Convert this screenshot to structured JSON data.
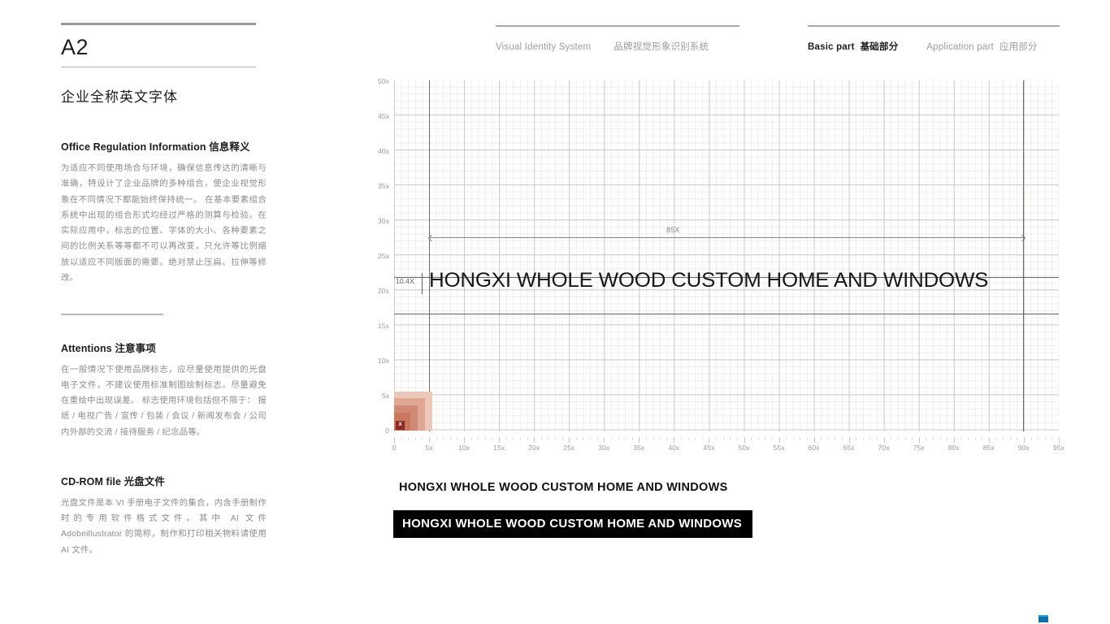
{
  "page": {
    "code": "A2",
    "section_title": "企业全称英文字体"
  },
  "header": {
    "left": {
      "en": "Visual Identity System",
      "cn": "品牌视觉形象识别系统"
    },
    "right": {
      "basic_en": "Basic part",
      "basic_cn": "基础部分",
      "application_en": "Application part",
      "application_cn": "应用部分"
    }
  },
  "sidebar": {
    "blocks": [
      {
        "head_en": "Office Regulation Information",
        "head_cn": "信息释义",
        "body": "为适应不同使用场合与环境，确保信息传达的清晰与准确，特设计了企业品牌的多种组合，使企业视觉形象在不同情况下都能始终保持统一。\n在基本要素组合系统中出现的组合形式均经过严格的测算与检验。在实际应用中，标志的位置、字体的大小、各种要素之间的比例关系等等都不可以再改变，只允许等比例缩放以适应不同版面的需要。绝对禁止压扁、拉伸等修改。"
      },
      {
        "head_en": "Attentions",
        "head_cn": "注意事项",
        "body": "在一般情况下使用品牌标志，应尽量使用提供的光盘电子文件，不建议使用标准制图绘制标志。尽量避免在重绘中出现误差。\n标志使用环境包括但不限于：\n报纸 / 电视广告 / 宣传 / 包装 / 会议 / 新闻发布会 / 公司内外部的交流 / 接待服务 / 纪念品等。"
      },
      {
        "head_en": "CD-ROM file",
        "head_cn": "光盘文件",
        "body": "光盘文件是本 VI 手册电子文件的集合，内含手册制作时的专用软件格式文件。其中 AI 文件 Adobeillustrator 的简称，制作和打印相关物料请使用 AI 文件。"
      }
    ]
  },
  "logotype": {
    "text": "HONGXI WHOLE WOOD CUSTOM HOME AND WINDOWS",
    "sample_plain": "HONGXI WHOLE WOOD CUSTOM HOME AND WINDOWS",
    "sample_inverse": "HONGXI WHOLE WOOD CUSTOM HOME AND WINDOWS"
  },
  "measurements": {
    "width_label": "85X",
    "height_label": "10.4X",
    "unit_marker": "X"
  },
  "chart_data": {
    "type": "grid-measurement",
    "title": "Logotype construction grid",
    "xlabel": "",
    "ylabel": "",
    "xlim": [
      0,
      95
    ],
    "ylim": [
      0,
      50
    ],
    "x_ticks": [
      "0",
      "5x",
      "10x",
      "15x",
      "20x",
      "25x",
      "30x",
      "35x",
      "40x",
      "45x",
      "50x",
      "55x",
      "60x",
      "65x",
      "70x",
      "75x",
      "80x",
      "85x",
      "90x",
      "95x"
    ],
    "x_tick_values": [
      0,
      5,
      10,
      15,
      20,
      25,
      30,
      35,
      40,
      45,
      50,
      55,
      60,
      65,
      70,
      75,
      80,
      85,
      90,
      95
    ],
    "y_ticks": [
      "0",
      "5x",
      "10x",
      "15x",
      "20x",
      "25x",
      "30x",
      "35x",
      "40x",
      "45x",
      "50x"
    ],
    "y_tick_values": [
      0,
      5,
      10,
      15,
      20,
      25,
      30,
      35,
      40,
      45,
      50
    ],
    "grid": true,
    "minor_grid_step": 1,
    "major_grid_step": 5,
    "guides": {
      "vertical": [
        5,
        90
      ],
      "horizontal": [
        25.7,
        20.4
      ]
    },
    "annotations": [
      {
        "label": "85X",
        "from_x": 5,
        "to_x": 90,
        "y": 27,
        "type": "width-dimension"
      },
      {
        "label": "10.4X",
        "x": 4,
        "from_y": 20.4,
        "to_y": 25.7,
        "type": "height-dimension"
      }
    ],
    "unit_swatch": {
      "label": "X",
      "x": 0,
      "y": 0,
      "width": 5.5,
      "height": 5.5
    }
  },
  "colors": {
    "text_dark": "#1d1d1d",
    "text_muted": "#8c8c8c",
    "rule": "#9a9a9a",
    "grid_major": "#cfc9c6",
    "grid_minor": "#f0eceb",
    "guide": "#6a6560",
    "swatch_1": "#ecc8bb",
    "swatch_2": "#e0a694",
    "swatch_3": "#d08a74",
    "swatch_4": "#c9785f",
    "swatch_badge": "#8f2a22",
    "inverse_bg": "#000000",
    "corner_mark": "#0f6ea3"
  }
}
